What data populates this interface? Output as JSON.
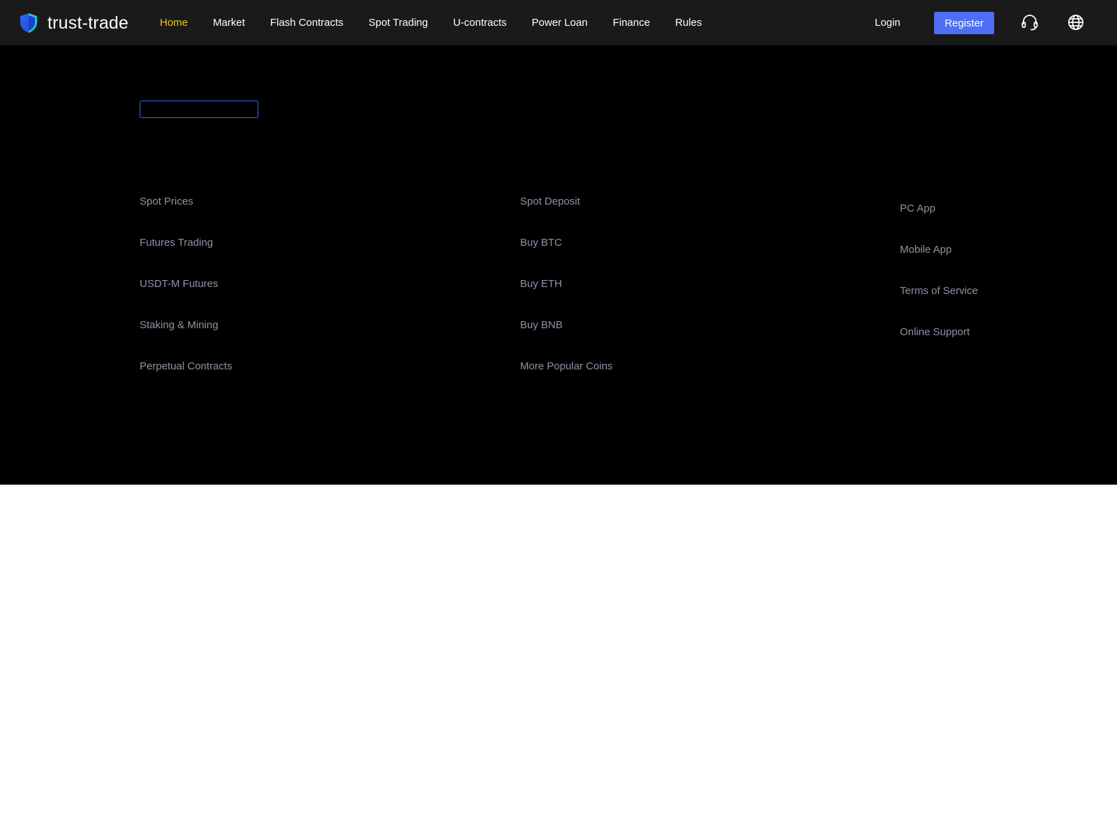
{
  "brand": {
    "name": "trust-trade",
    "logo_colors": {
      "primary": "#2d6cf6",
      "accent": "#1fd6c8"
    }
  },
  "nav": {
    "items": [
      {
        "label": "Home",
        "active": true
      },
      {
        "label": "Market",
        "active": false
      },
      {
        "label": "Flash Contracts",
        "active": false
      },
      {
        "label": "Spot Trading",
        "active": false
      },
      {
        "label": "U-contracts",
        "active": false
      },
      {
        "label": "Power Loan",
        "active": false
      },
      {
        "label": "Finance",
        "active": false
      },
      {
        "label": "Rules",
        "active": false
      }
    ],
    "active_color": "#f0c419"
  },
  "auth": {
    "login_label": "Login",
    "register_label": "Register",
    "register_color": "#4d6ef5"
  },
  "header_icons": {
    "support": "headset-icon",
    "language": "globe-icon"
  },
  "footer": {
    "columns": [
      {
        "links": [
          "Spot Prices",
          "Futures Trading",
          "USDT-M Futures",
          "Staking & Mining",
          "Perpetual Contracts"
        ]
      },
      {
        "links": [
          "Spot Deposit",
          "Buy BTC",
          "Buy ETH",
          "Buy BNB",
          "More Popular Coins"
        ]
      },
      {
        "links": [
          "PC App",
          "Mobile App",
          "Terms of Service",
          "Online Support"
        ]
      }
    ],
    "link_color": "#8b95a7"
  }
}
